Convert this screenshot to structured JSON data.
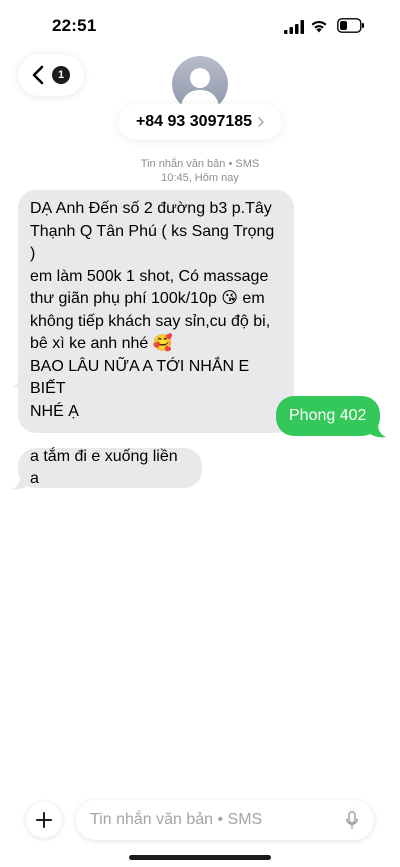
{
  "status_bar": {
    "time": "22:51",
    "icons": [
      "signal-icon",
      "wifi-icon",
      "battery-icon"
    ]
  },
  "header": {
    "back_badge": "1",
    "contact": "+84 93 3097185",
    "avatar_icon": "person-silhouette-icon"
  },
  "thread": {
    "service_label": "Tin nhắn văn bản • SMS",
    "timestamp": "10:45, Hôm nay",
    "messages": [
      {
        "direction": "incoming",
        "text": "DẠ Anh Đến số 2 đường b3 p.Tây\nThạnh Q Tân Phú ( ks Sang Trọng )\nem làm 500k 1 shot, Có massage\nthư giãn phụ phí 100k/10p 😘 em\nkhông tiếp khách say sỉn,cu độ bi,\nbê xì ke anh nhé 🥰\nBAO LÂU NỮA A TỚI NHẮN E BIẾT\nNHÉ Ạ"
      },
      {
        "direction": "outgoing",
        "text": "Phong 402"
      },
      {
        "direction": "incoming",
        "text": "a tắm đi e xuống liền a"
      }
    ]
  },
  "composer": {
    "placeholder": "Tin nhắn văn bản • SMS"
  },
  "colors": {
    "incoming_bubble": "#e9e9eb",
    "outgoing_bubble": "#34c759",
    "meta_text": "#8e8e93",
    "avatar_bg": "#a5abbd"
  }
}
